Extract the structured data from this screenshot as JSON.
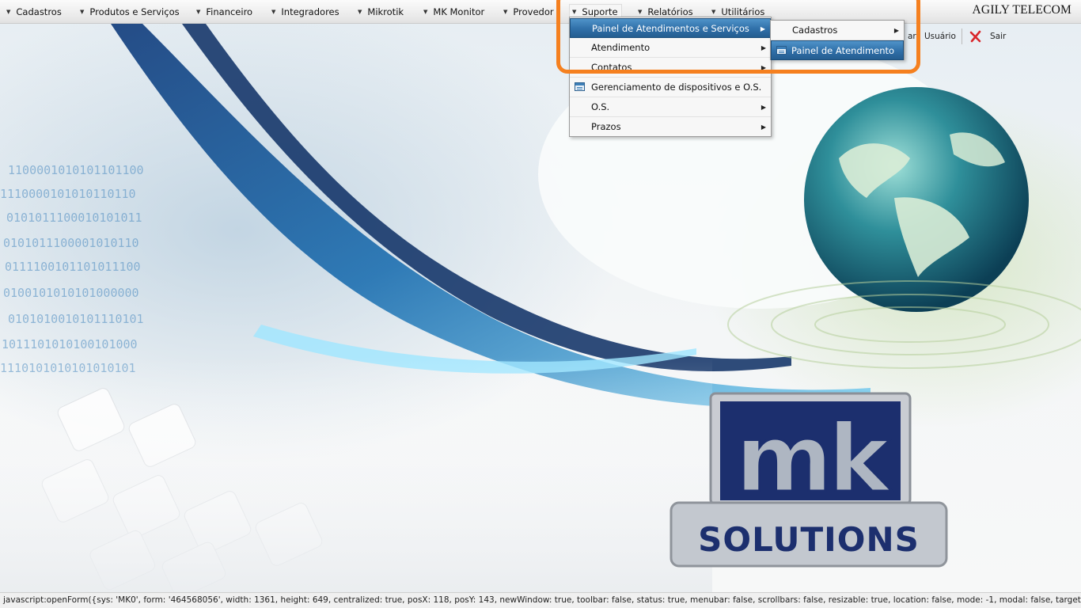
{
  "menubar": {
    "items": [
      {
        "label": "Cadastros"
      },
      {
        "label": "Produtos e Serviços"
      },
      {
        "label": "Financeiro"
      },
      {
        "label": "Integradores"
      },
      {
        "label": "Mikrotik"
      },
      {
        "label": "MK Monitor"
      },
      {
        "label": "Provedor"
      },
      {
        "label": "Suporte"
      },
      {
        "label": "Relatórios"
      },
      {
        "label": "Utilitários"
      }
    ],
    "active": "Suporte",
    "brand": "AGILY TELECOM"
  },
  "subbar": {
    "partial_label": "ar",
    "user_label": "Usuário",
    "exit_label": "Sair"
  },
  "suporte_menu": {
    "items": [
      {
        "label": "Painel de Atendimentos e Serviços",
        "has_submenu": true,
        "highlighted": true
      },
      {
        "label": "Atendimento",
        "has_submenu": true
      },
      {
        "label": "Contatos",
        "has_submenu": true
      },
      {
        "label": "Gerenciamento de dispositivos e O.S.",
        "has_submenu": false,
        "icon": "form-icon"
      },
      {
        "label": "O.S.",
        "has_submenu": true
      },
      {
        "label": "Prazos",
        "has_submenu": true
      }
    ]
  },
  "painel_submenu": {
    "items": [
      {
        "label": "Cadastros",
        "has_submenu": true
      },
      {
        "label": "Painel de Atendimento",
        "has_submenu": false,
        "icon": "form-icon",
        "highlighted": true
      }
    ]
  },
  "logo": {
    "letters": "mk",
    "word": "SOLUTIONS"
  },
  "statusbar": {
    "text": "javascript:openForm({sys: 'MK0', form: '464568056', width: 1361, height: 649, centralized: true, posX: 118, posY: 143, newWindow: true, toolbar: false, status: true, menubar: false, scrollbars: false, resizable: true, location: false, mode: -1, modal: false, target..."
  },
  "colors": {
    "highlight": "#2f6fa8",
    "callout": "#f5801f",
    "logo_navy": "#1c2f6e"
  }
}
